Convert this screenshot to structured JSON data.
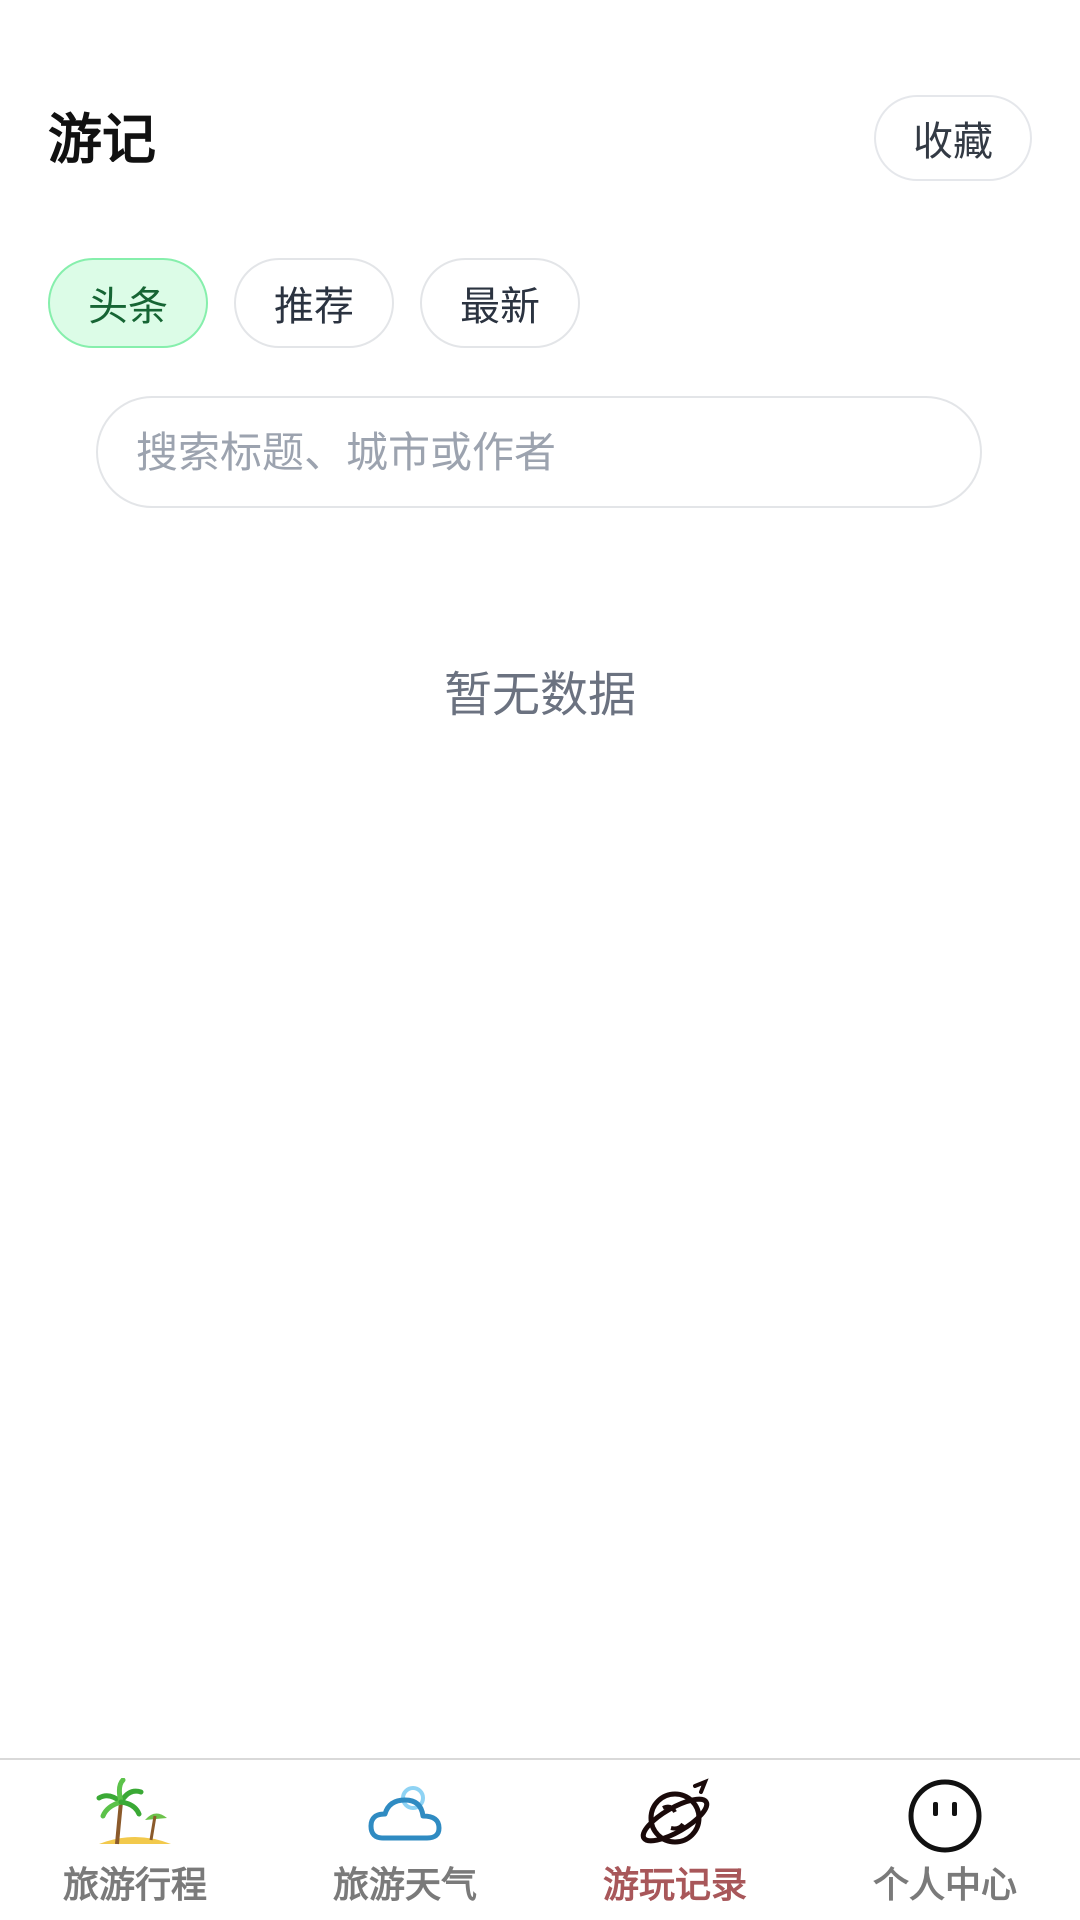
{
  "header": {
    "title": "游记",
    "favorite_label": "收藏"
  },
  "tabs": [
    {
      "label": "头条",
      "active": true
    },
    {
      "label": "推荐",
      "active": false
    },
    {
      "label": "最新",
      "active": false
    }
  ],
  "search": {
    "placeholder": "搜索标题、城市或作者",
    "value": ""
  },
  "empty_state": {
    "text": "暂无数据"
  },
  "tabbar": {
    "items": [
      {
        "label": "旅游行程",
        "icon": "palm-tree-icon",
        "active": false
      },
      {
        "label": "旅游天气",
        "icon": "cloud-sun-icon",
        "active": false
      },
      {
        "label": "游玩记录",
        "icon": "planet-icon",
        "active": true
      },
      {
        "label": "个人中心",
        "icon": "face-icon",
        "active": false
      }
    ]
  },
  "colors": {
    "active_tab_bg": "#dcfce7",
    "active_tab_border": "#86efac",
    "active_tab_text": "#166534",
    "tabbar_active_text": "#a8575a",
    "tabbar_inactive_text": "#7a7a7a"
  }
}
